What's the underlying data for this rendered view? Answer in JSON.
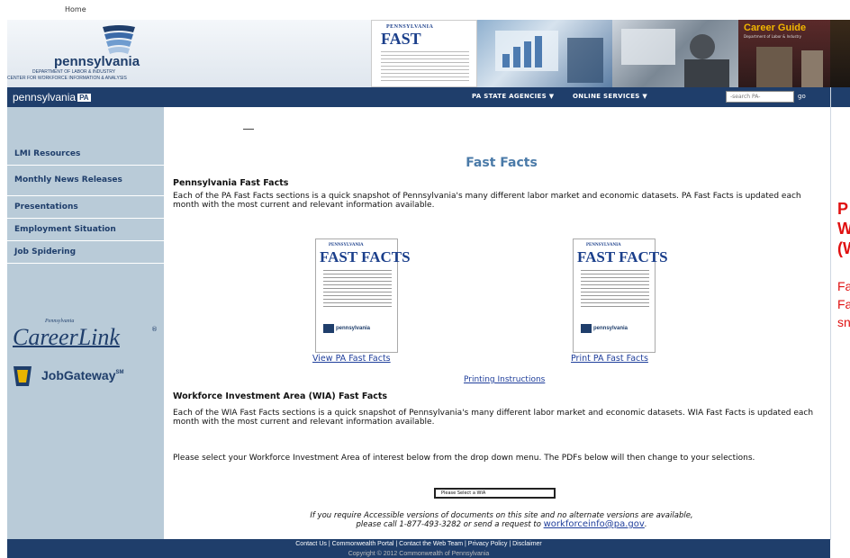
{
  "top": {
    "home_link": "Home"
  },
  "header": {
    "logo_name": "pennsylvania",
    "logo_dept": "DEPARTMENT OF LABOR & INDUSTRY",
    "logo_center": "CENTER FOR WORKFORCE INFORMATION & ANALYSIS",
    "banner_ff_top": "PENNSYLVANIA",
    "banner_ff_title": "FAST FACTS",
    "career_title": "Career Guide",
    "career_sub": "Department of Labor & Industry"
  },
  "navbar": {
    "brand": "pennsylvania",
    "brand_badge": "PA",
    "agencies": "PA STATE AGENCIES ▼",
    "online": "ONLINE SERVICES ▼",
    "search_placeholder": "-search PA-",
    "go": "go"
  },
  "sidebar": {
    "items": [
      {
        "label": "LMI Resources"
      },
      {
        "label": "Monthly News Releases"
      },
      {
        "label": "Presentations"
      },
      {
        "label": "Employment Situation"
      },
      {
        "label": "Job Spidering"
      }
    ],
    "careerlink_small": "Pennsylvania",
    "careerlink": "CareerLink",
    "careerlink_reg": "®",
    "jobgateway": "JobGateway",
    "jobgateway_sm": "SM"
  },
  "main": {
    "title": "Fast Facts",
    "pa_heading": "Pennsylvania Fast Facts",
    "pa_para": "Each of the PA Fast Facts sections is a quick snapshot of Pennsylvania's many different labor market and economic datasets. PA Fast Facts is updated each month with the most current and relevant information available.",
    "thumb_top": "PENNSYLVANIA",
    "thumb_title": "FAST FACTS",
    "thumb_logo": "pennsylvania",
    "view_link": "View PA Fast Facts",
    "print_link": "Print PA Fast Facts",
    "printing_instructions": "Printing Instructions",
    "wia_heading": "Workforce Investment Area (WIA) Fast Facts",
    "wia_para": "Each of the WIA Fast Facts sections is a quick snapshot of Pennsylvania's many different labor market and economic datasets. WIA Fast Facts is updated each month with the most current and relevant information available.",
    "select_para": "Please select your Workforce Investment Area of interest below from the drop down menu. The PDFs below will then change to your selections.",
    "wia_select": "Please Select a WIA",
    "access_line1": "If you require Accessible versions of documents on this site and no alternate versions are available,",
    "access_line2": "please call 1-877-493-3282 or send a request to",
    "email": "workforceinfo@pa.gov",
    "access_end": "."
  },
  "footer": {
    "links": "Contact Us | Commonwealth Portal | Contact the Web Team | Privacy Policy | Disclaimer",
    "copyright": "Copyright © 2012 Commonwealth of Pennsylvania"
  },
  "right_panel": {
    "line1": "P",
    "line2": "W",
    "line3": "(W",
    "line4": "Fa",
    "line5": "Fa",
    "line6": "sn"
  }
}
